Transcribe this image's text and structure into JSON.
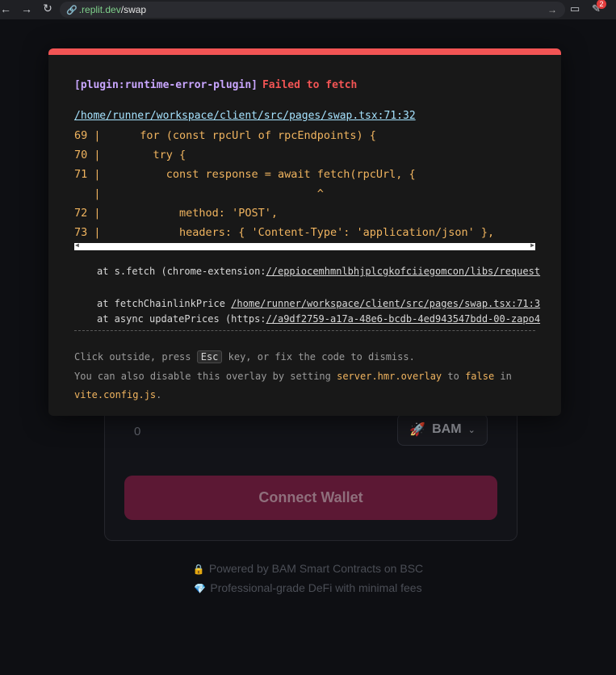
{
  "browser": {
    "url_host": ".replit.dev",
    "url_path": "/swap",
    "extension_badge": "2"
  },
  "app": {
    "amount_value": "0",
    "token": "BAM",
    "connect_label": "Connect Wallet",
    "footer_line1": "Powered by BAM Smart Contracts on BSC",
    "footer_line2": "Professional-grade DeFi with minimal fees"
  },
  "overlay": {
    "plugin": "[plugin:runtime-error-plugin]",
    "message": "Failed to fetch",
    "file": "/home/runner/workspace/client/src/pages/swap.tsx:71:32",
    "code_lines": [
      "69 |      for (const rpcUrl of rpcEndpoints) {",
      "70 |        try {",
      "71 |          const response = await fetch(rpcUrl, {",
      "   |                                 ^",
      "72 |            method: 'POST',",
      "73 |            headers: { 'Content-Type': 'application/json' },"
    ],
    "stack": {
      "line1_prefix": "at s.fetch (chrome-extension:",
      "line1_link": "//eppiocemhmnlbhjplcgkofciiegomcon/libs/request",
      "line2_prefix": "at fetchChainlinkPrice ",
      "line2_link": "/home/runner/workspace/client/src/pages/swap.tsx:71:3",
      "line3_prefix": "at async updatePrices (https:",
      "line3_link": "//a9df2759-a17a-48e6-bcdb-4ed943547bdd-00-zapo4"
    },
    "tip1_a": "Click outside, press ",
    "tip1_key": "Esc",
    "tip1_b": " key, or fix the code to dismiss.",
    "tip2_a": "You can also disable this overlay by setting ",
    "tip2_setting": "server.hmr.overlay",
    "tip2_b": " to ",
    "tip2_false": "false",
    "tip2_c": " in",
    "tip3_file": "vite.config.js",
    "tip3_end": "."
  }
}
